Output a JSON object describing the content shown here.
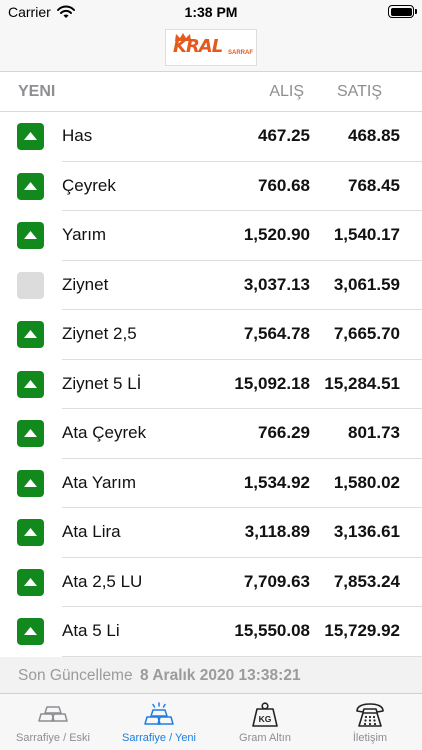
{
  "status_bar": {
    "carrier": "Carrier",
    "time": "1:38 PM"
  },
  "brand": {
    "logo_text": "KRAL",
    "logo_subtext": "SARRAF",
    "color": "#e55a1c"
  },
  "table": {
    "title": "YENI",
    "buy_header": "ALIŞ",
    "sell_header": "SATIŞ",
    "rows": [
      {
        "name": "Has",
        "buy": "467.25",
        "sell": "468.85",
        "trend": "up"
      },
      {
        "name": "Çeyrek",
        "buy": "760.68",
        "sell": "768.45",
        "trend": "up"
      },
      {
        "name": "Yarım",
        "buy": "1,520.90",
        "sell": "1,540.17",
        "trend": "up"
      },
      {
        "name": "Ziynet",
        "buy": "3,037.13",
        "sell": "3,061.59",
        "trend": "none"
      },
      {
        "name": "Ziynet 2,5",
        "buy": "7,564.78",
        "sell": "7,665.70",
        "trend": "up"
      },
      {
        "name": "Ziynet 5 Lİ",
        "buy": "15,092.18",
        "sell": "15,284.51",
        "trend": "up"
      },
      {
        "name": "Ata Çeyrek",
        "buy": "766.29",
        "sell": "801.73",
        "trend": "up"
      },
      {
        "name": "Ata Yarım",
        "buy": "1,534.92",
        "sell": "1,580.02",
        "trend": "up"
      },
      {
        "name": "Ata Lira",
        "buy": "3,118.89",
        "sell": "3,136.61",
        "trend": "up"
      },
      {
        "name": "Ata 2,5 LU",
        "buy": "7,709.63",
        "sell": "7,853.24",
        "trend": "up"
      },
      {
        "name": "Ata 5 Li",
        "buy": "15,550.08",
        "sell": "15,729.92",
        "trend": "up"
      }
    ]
  },
  "footer": {
    "update_label": "Son Güncelleme",
    "update_time": "8 Aralık 2020 13:38:21"
  },
  "tabs": [
    {
      "label": "Sarrafiye / Eski",
      "icon": "gold-bars-icon",
      "active": false
    },
    {
      "label": "Sarrafiye / Yeni",
      "icon": "gold-bars-new-icon",
      "active": true
    },
    {
      "label": "Gram Altın",
      "icon": "kg-weight-icon",
      "active": false
    },
    {
      "label": "İletişim",
      "icon": "telephone-icon",
      "active": false
    }
  ],
  "colors": {
    "trend_up": "#12891d",
    "trend_none": "#dcdcdc",
    "tab_active": "#1f7ee3",
    "tab_inactive": "#8e8e93"
  }
}
